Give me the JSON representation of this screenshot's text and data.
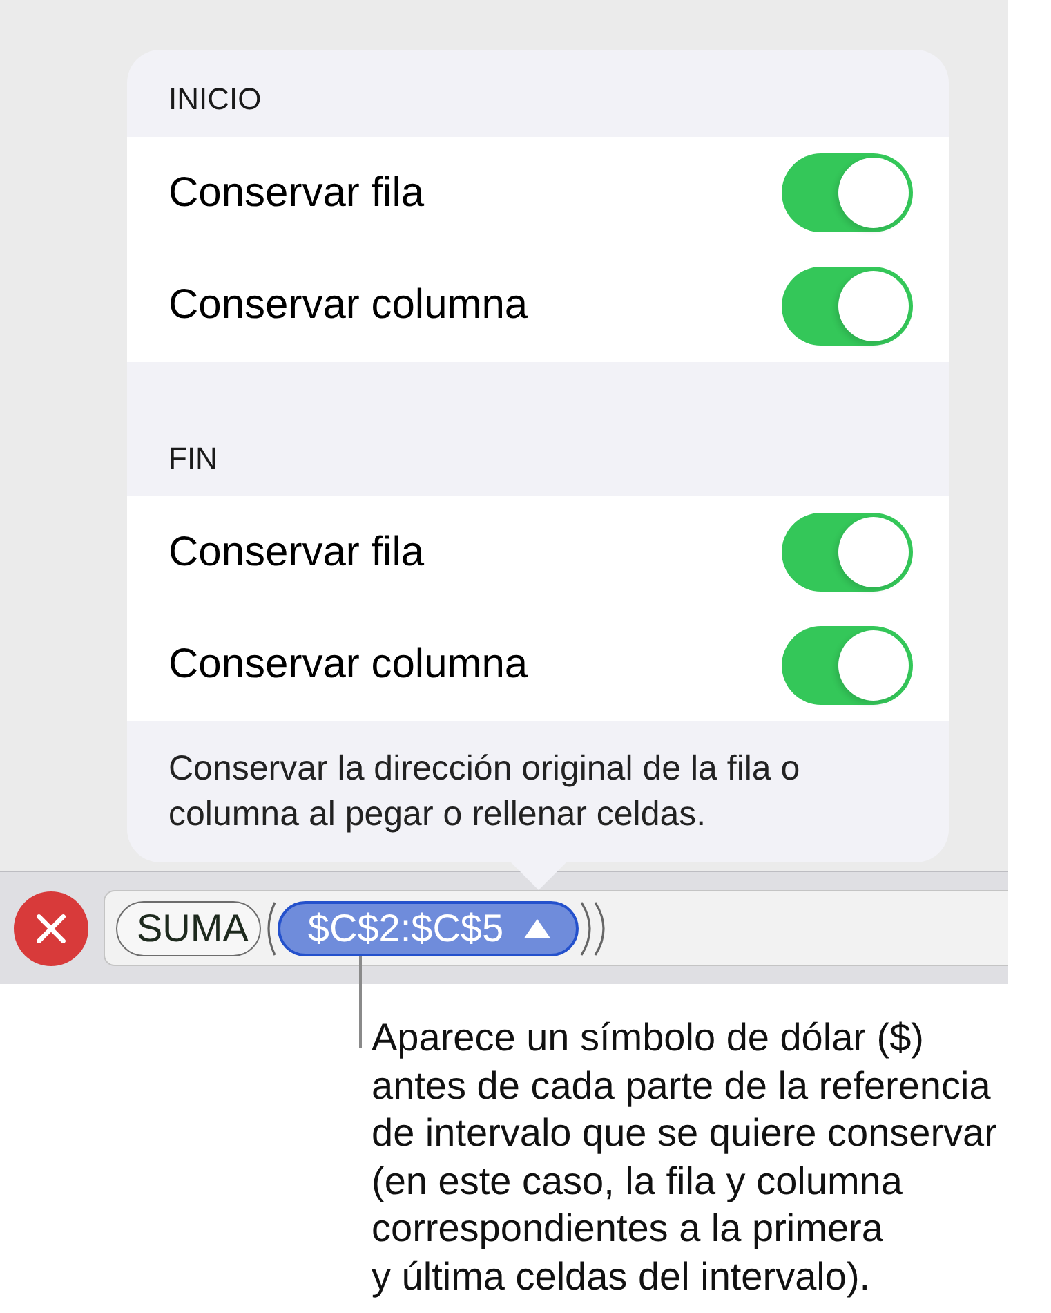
{
  "popover": {
    "sections": [
      {
        "header": "INICIO",
        "rows": [
          {
            "label": "Conservar fila",
            "on": true
          },
          {
            "label": "Conservar columna",
            "on": true
          }
        ]
      },
      {
        "header": "FIN",
        "rows": [
          {
            "label": "Conservar fila",
            "on": true
          },
          {
            "label": "Conservar columna",
            "on": true
          }
        ]
      }
    ],
    "footer": "Conservar la dirección original de la fila o\ncolumna al pegar o rellenar celdas."
  },
  "formula_bar": {
    "tokens": [
      {
        "kind": "function",
        "text": "SUMA",
        "selected": false
      },
      {
        "kind": "range",
        "text": "$C$2:$C$5",
        "selected": true
      }
    ]
  },
  "callout": {
    "text": "Aparece un símbolo de dólar ($)\nantes de cada parte de la referencia\nde intervalo que se quiere conservar\n(en este caso, la fila y columna\ncorrespondientes a la primera\ny última celdas del intervalo)."
  }
}
